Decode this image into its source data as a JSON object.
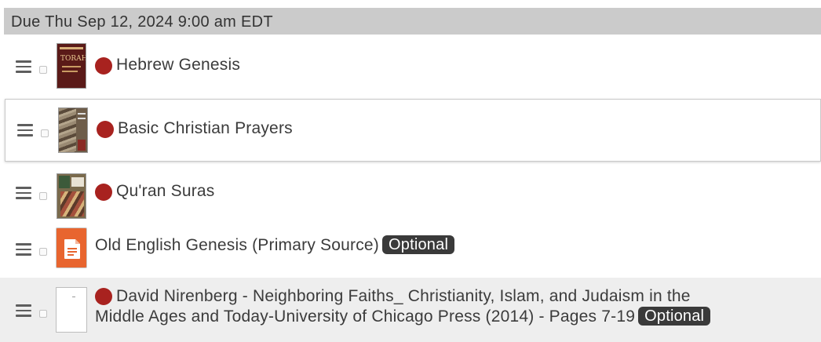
{
  "due_header": "Due Thu Sep 12, 2024 9:00 am EDT",
  "colors": {
    "header_bg": "#cbcbcb",
    "dot": "#a8221f",
    "badge_bg": "#3a3a3a",
    "doc_icon": "#e8652f"
  },
  "items": [
    {
      "title": "Hebrew Genesis",
      "thumb": "book-cover-torah",
      "status_dot": true
    },
    {
      "title": "Basic Christian Prayers",
      "thumb": "book-cover-prayers",
      "status_dot": true
    },
    {
      "title": "Qu'ran Suras",
      "thumb": "book-cover-quran",
      "status_dot": true
    },
    {
      "title": "Old English Genesis (Primary Source)",
      "thumb": "google-doc-icon",
      "status_dot": false,
      "badge": "Optional"
    },
    {
      "title_line1": "David Nirenberg - Neighboring Faiths_ Christianity, Islam, and Judaism in the",
      "title_line2": "Middle Ages and Today-University of Chicago Press (2014) - Pages 7-19",
      "thumb": "blank-pdf-thumbnail",
      "status_dot": true,
      "badge": "Optional"
    }
  ]
}
